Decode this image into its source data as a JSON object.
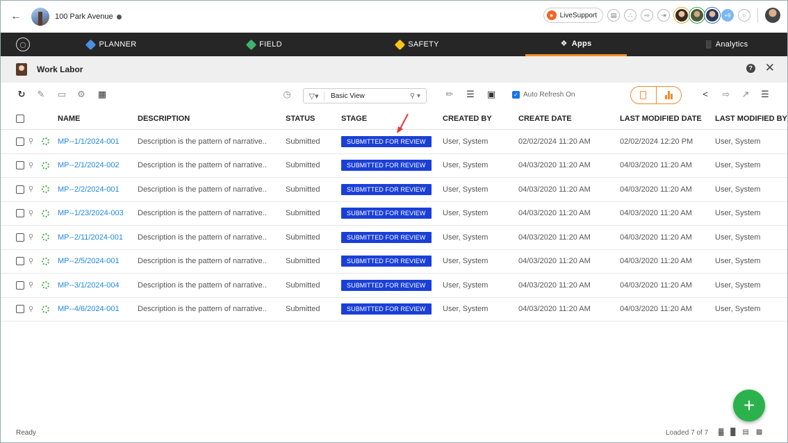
{
  "project": {
    "name": "100 Park Avenue"
  },
  "top": {
    "live_support_label": "LiveSupport",
    "more_users": "+9"
  },
  "nav": {
    "items": [
      {
        "label": "PLANNER",
        "icon_color": "#4a90e2"
      },
      {
        "label": "FIELD",
        "icon_color": "#3cb371"
      },
      {
        "label": "SAFETY",
        "icon_color": "#f5c518"
      },
      {
        "label": "Apps",
        "icon": "apps-icon"
      },
      {
        "label": "Analytics",
        "icon": "analytics-icon"
      }
    ],
    "active": "Apps",
    "active_color": "#f28c2a"
  },
  "module": {
    "title": "Work Labor"
  },
  "toolbar": {
    "view_name": "Basic View",
    "auto_refresh_label": "Auto Refresh On",
    "accent_color": "#f28c2a"
  },
  "table": {
    "headers": [
      "NAME",
      "DESCRIPTION",
      "STATUS",
      "STAGE",
      "CREATED BY",
      "CREATE DATE",
      "LAST MODIFIED DATE",
      "LAST MODIFIED BY"
    ],
    "rows": [
      {
        "name": "MP--1/1/2024-001",
        "description": "Description is the pattern of narrative..",
        "status": "Submitted",
        "stage": "SUBMITTED FOR REVIEW",
        "created_by": "User, System",
        "create_date": "02/02/2024 11:20 AM",
        "last_modified_date": "02/02/2024 12:20 PM",
        "last_modified_by": "User, System"
      },
      {
        "name": "MP--2/1/2024-002",
        "description": "Description is the pattern of narrative..",
        "status": "Submitted",
        "stage": "SUBMITTED FOR REVIEW",
        "created_by": "User, System",
        "create_date": "04/03/2020 11:20 AM",
        "last_modified_date": "04/03/2020 11:20 AM",
        "last_modified_by": "User, System"
      },
      {
        "name": "MP--2/2/2024-001",
        "description": "Description is the pattern of narrative..",
        "status": "Submitted",
        "stage": "SUBMITTED FOR REVIEW",
        "created_by": "User, System",
        "create_date": "04/03/2020 11:20 AM",
        "last_modified_date": "04/03/2020 11:20 AM",
        "last_modified_by": "User, System"
      },
      {
        "name": "MP--1/23/2024-003",
        "description": "Description is the pattern of narrative..",
        "status": "Submitted",
        "stage": "SUBMITTED FOR REVIEW",
        "created_by": "User, System",
        "create_date": "04/03/2020 11:20 AM",
        "last_modified_date": "04/03/2020 11:20 AM",
        "last_modified_by": "User, System"
      },
      {
        "name": "MP--2/11/2024-001",
        "description": "Description is the pattern of narrative..",
        "status": "Submitted",
        "stage": "SUBMITTED FOR REVIEW",
        "created_by": "User, System",
        "create_date": "04/03/2020 11:20 AM",
        "last_modified_date": "04/03/2020 11:20 AM",
        "last_modified_by": "User, System"
      },
      {
        "name": "MP--2/5/2024-001",
        "description": "Description is the pattern of narrative..",
        "status": "Submitted",
        "stage": "SUBMITTED FOR REVIEW",
        "created_by": "User, System",
        "create_date": "04/03/2020 11:20 AM",
        "last_modified_date": "04/03/2020 11:20 AM",
        "last_modified_by": "User, System"
      },
      {
        "name": "MP--3/1/2024-004",
        "description": "Description is the pattern of narrative..",
        "status": "Submitted",
        "stage": "SUBMITTED FOR REVIEW",
        "created_by": "User, System",
        "create_date": "04/03/2020 11:20 AM",
        "last_modified_date": "04/03/2020 11:20 AM",
        "last_modified_by": "User, System"
      },
      {
        "name": "MP--4/6/2024-001",
        "description": "Description is the pattern of narrative..",
        "status": "Submitted",
        "stage": "SUBMITTED FOR REVIEW",
        "created_by": "User, System",
        "create_date": "04/03/2020 11:20 AM",
        "last_modified_date": "04/03/2020 11:20 AM",
        "last_modified_by": "User, System"
      }
    ],
    "stage_color": "#1a3fd8",
    "link_color": "#1e88e5"
  },
  "footer": {
    "status": "Ready",
    "loaded": "Loaded 7 of 7"
  },
  "fab": {
    "label": "+",
    "color": "#2bb24c"
  },
  "annotation": {
    "arrow_color": "#e53935"
  }
}
